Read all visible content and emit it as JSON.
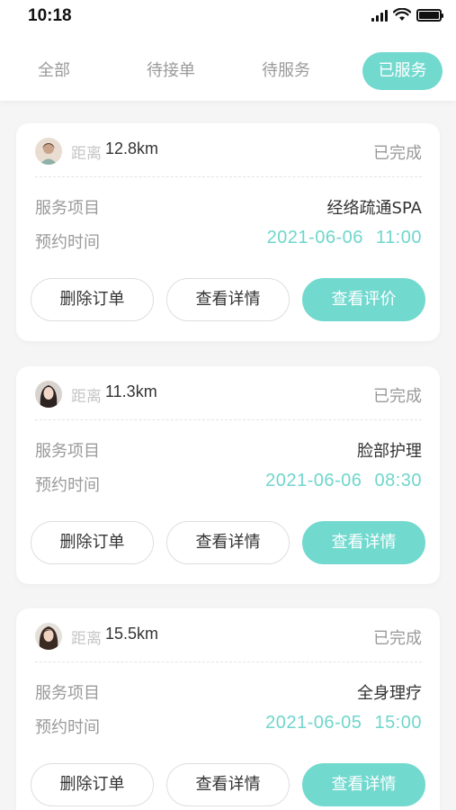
{
  "status_bar": {
    "time": "10:18"
  },
  "tabs": [
    {
      "label": "全部"
    },
    {
      "label": "待接单"
    },
    {
      "label": "待服务"
    },
    {
      "label": "已服务"
    }
  ],
  "active_tab_index": 3,
  "colors": {
    "accent": "#72d9cf",
    "time_text": "#6fd6cc",
    "muted": "#9a9a9a",
    "background": "#f5f5f6"
  },
  "orders": [
    {
      "distance_label": "距离",
      "distance": "12.8km",
      "status": "已完成",
      "service_label": "服务项目",
      "service": "经络疏通SPA",
      "time_label": "预约时间",
      "time": "2021-06-06 11:00",
      "buttons": {
        "delete": "删除订单",
        "details": "查看详情",
        "primary": "查看评价"
      }
    },
    {
      "distance_label": "距离",
      "distance": "11.3km",
      "status": "已完成",
      "service_label": "服务项目",
      "service": "脸部护理",
      "time_label": "预约时间",
      "time": "2021-06-06 08:30",
      "buttons": {
        "delete": "删除订单",
        "details": "查看详情",
        "primary": "查看详情"
      }
    },
    {
      "distance_label": "距离",
      "distance": "15.5km",
      "status": "已完成",
      "service_label": "服务项目",
      "service": "全身理疗",
      "time_label": "预约时间",
      "time": "2021-06-05 15:00",
      "buttons": {
        "delete": "删除订单",
        "details": "查看详情",
        "primary": "查看详情"
      }
    }
  ]
}
